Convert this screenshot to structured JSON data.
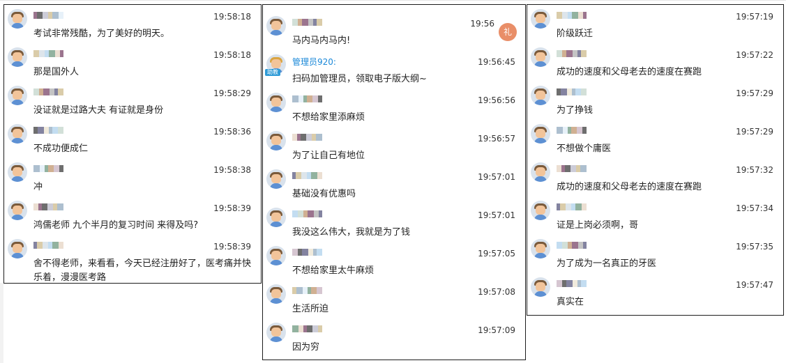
{
  "panels": {
    "left": {
      "messages": [
        {
          "time": "19:58:18",
          "text": "考试非常残酷，为了美好的明天。"
        },
        {
          "time": "19:58:18",
          "text": "那是国外人"
        },
        {
          "time": "19:58:29",
          "text": "没证就是过路大夫 有证就是身份"
        },
        {
          "time": "19:58:36",
          "text": "不成功便成仁"
        },
        {
          "time": "19:58:38",
          "text": "冲"
        },
        {
          "time": "19:58:39",
          "text": "鸿儒老师 九个半月的复习时间 来得及吗?"
        },
        {
          "time": "19:58:39",
          "text": "舍不得老师，来看看，今天已经注册好了，医考痛并快乐着，漫漫医考路"
        }
      ]
    },
    "middle": {
      "messages": [
        {
          "time": "19:56",
          "text": "马内马内马内!"
        },
        {
          "time": "19:56:45",
          "text": "扫码加管理员，领取电子版大纲~",
          "name": "管理员920:",
          "badge": "助教"
        },
        {
          "time": "19:56:56",
          "text": "不想给家里添麻烦"
        },
        {
          "time": "19:56:57",
          "text": "为了让自己有地位"
        },
        {
          "time": "19:57:01",
          "text": "基础没有优惠吗"
        },
        {
          "time": "19:57:01",
          "text": "我没这么伟大，我就是为了钱"
        },
        {
          "time": "19:57:05",
          "text": "不想给家里太牛麻烦"
        },
        {
          "time": "19:57:08",
          "text": "生活所迫"
        },
        {
          "time": "19:57:09",
          "text": "因为穷"
        }
      ]
    },
    "right": {
      "messages": [
        {
          "time": "19:57:19",
          "text": "阶级跃迁"
        },
        {
          "time": "19:57:22",
          "text": "成功的速度和父母老去的速度在赛跑"
        },
        {
          "time": "19:57:29",
          "text": "为了挣钱"
        },
        {
          "time": "19:57:29",
          "text": "不想做个庸医"
        },
        {
          "time": "19:57:32",
          "text": "成功的速度和父母老去的速度在赛跑"
        },
        {
          "time": "19:57:34",
          "text": "证是上岗必须啊，哥"
        },
        {
          "time": "19:57:35",
          "text": "为了成为一名真正的牙医"
        },
        {
          "time": "19:57:47",
          "text": "真实在"
        }
      ]
    }
  },
  "gift_glyph": "礼",
  "colors": {
    "name_blue": "#1a88d8",
    "gift_orange": "#e98e68",
    "blur_palette": [
      "#9fb4c7",
      "#c8a27f",
      "#6d6d8f",
      "#b9d7ee",
      "#8a5c7a",
      "#d3c39a",
      "#7fa58e",
      "#555555"
    ]
  }
}
